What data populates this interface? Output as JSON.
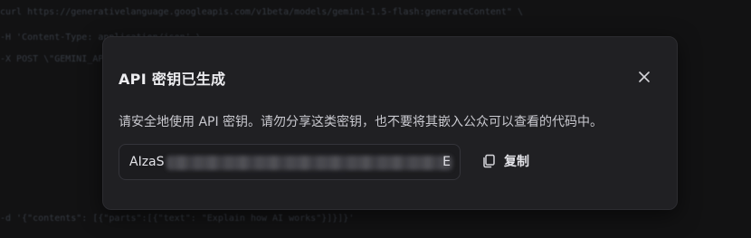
{
  "background": {
    "code_lines": [
      "curl https://generativelanguage.googleapis.com/v1beta/models/gemini-1.5-flash:generateContent\" \\",
      "  -H 'Content-Type: application/json' \\",
      "  -X POST \\\"GEMINI_API_KEY\\\""
    ],
    "bottom_code_line": "  -d '{\"contents\": [{\"parts\":[{\"text\": \"Explain how AI works\"}]}]}'"
  },
  "dialog": {
    "title": "API 密钥已生成",
    "close_icon": "close-icon",
    "description": "请安全地使用 API 密钥。请勿分享这类密钥，也不要将其嵌入公众可以查看的代码中。",
    "key": {
      "visible_prefix": "AIzaS",
      "visible_suffix": "E",
      "masked": true
    },
    "copy_button": {
      "icon": "copy-icon",
      "label": "复制"
    }
  },
  "colors": {
    "background": "#18181a",
    "dialog_bg": "#202023",
    "text_primary": "#ededf0",
    "text_secondary": "#c9c9cf"
  }
}
